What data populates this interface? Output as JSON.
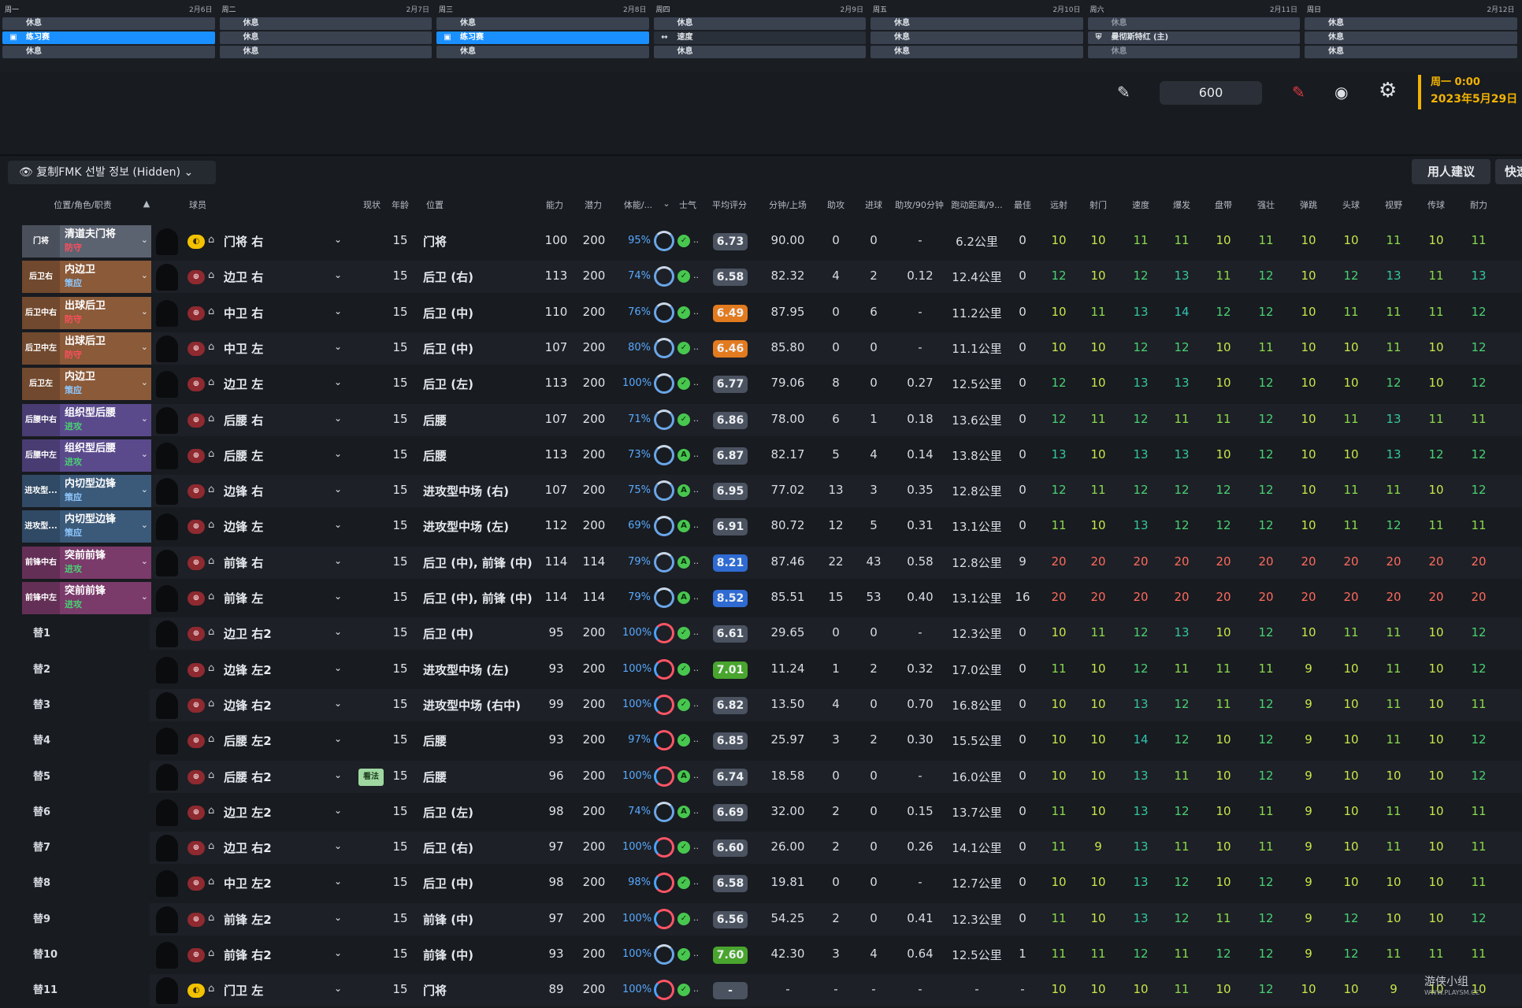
{
  "calendar": {
    "days": [
      {
        "weekday": "周一",
        "date": "2月6日"
      },
      {
        "weekday": "周二",
        "date": "2月7日"
      },
      {
        "weekday": "周三",
        "date": "2月8日"
      },
      {
        "weekday": "周四",
        "date": "2月9日"
      },
      {
        "weekday": "周五",
        "date": "2月10日"
      },
      {
        "weekday": "周六",
        "date": "2月11日"
      },
      {
        "weekday": "周日",
        "date": "2月12日"
      }
    ],
    "slots": [
      [
        {
          "t": "休息",
          "k": "rest"
        },
        {
          "t": "练习赛",
          "k": "train"
        },
        {
          "t": "休息",
          "k": "rest"
        }
      ],
      [
        {
          "t": "休息",
          "k": "rest"
        },
        {
          "t": "休息",
          "k": "rest"
        },
        {
          "t": "休息",
          "k": "rest"
        }
      ],
      [
        {
          "t": "休息",
          "k": "rest"
        },
        {
          "t": "练习赛",
          "k": "train"
        },
        {
          "t": "休息",
          "k": "rest"
        }
      ],
      [
        {
          "t": "休息",
          "k": "rest"
        },
        {
          "t": "速度",
          "k": "dark"
        },
        {
          "t": "休息",
          "k": "rest"
        }
      ],
      [
        {
          "t": "休息",
          "k": "rest"
        },
        {
          "t": "休息",
          "k": "rest"
        },
        {
          "t": "休息",
          "k": "rest"
        }
      ],
      [
        {
          "t": "休息",
          "k": "fade"
        },
        {
          "t": "曼彻斯特红 (主)",
          "k": "match"
        },
        {
          "t": "休息",
          "k": "fade"
        }
      ],
      [
        {
          "t": "休息",
          "k": "rest"
        },
        {
          "t": "休息",
          "k": "rest"
        },
        {
          "t": "休息",
          "k": "rest"
        }
      ]
    ]
  },
  "toolbar": {
    "budget": "600",
    "date_line1": "周一 0:00",
    "date_line2": "2023年5月29日"
  },
  "view_selector": {
    "label": "复制FMK 선발 정보 (Hidden)"
  },
  "buttons": {
    "advice": "用人建议",
    "quick": "快速"
  },
  "headers": {
    "position_role": "位置/角色/职责",
    "player": "球员",
    "status": "现状",
    "age": "年龄",
    "position": "位置",
    "ca": "能力",
    "pa": "潜力",
    "condition": "体能/...",
    "morale": "士气",
    "avg_rating": "平均评分",
    "mins_per_app": "分钟/上场",
    "assists": "助攻",
    "goals": "进球",
    "assists_per90": "助攻/90分钟",
    "distance_per90": "跑动距离/9...",
    "best": "最佳",
    "attrs": [
      "远射",
      "射门",
      "速度",
      "爆发",
      "盘带",
      "强壮",
      "弹跳",
      "头球",
      "视野",
      "传球",
      "耐力"
    ]
  },
  "rows": [
    {
      "code": "门将",
      "role": "清道夫门将",
      "duty": "防守",
      "dc": "#ff4f5e",
      "bg": "#5b6270",
      "badge": "gk",
      "name": "门将 右",
      "age": "15",
      "pos": "门将",
      "ca": "100",
      "pa": "200",
      "cond": "95%",
      "ring": "b",
      "mor": "✓",
      "rating": "6.73",
      "rc": "g",
      "mins": "90.00",
      "ast": "0",
      "gls": "0",
      "a90": "-",
      "dist": "6.2公里",
      "best": "0",
      "attrs": [
        10,
        10,
        11,
        11,
        10,
        11,
        10,
        10,
        11,
        10,
        11
      ]
    },
    {
      "code": "后卫右",
      "role": "内边卫",
      "duty": "策应",
      "dc": "#8fc9ff",
      "bg": "#8a5a39",
      "badge": "out",
      "name": "边卫 右",
      "age": "15",
      "pos": "后卫 (右)",
      "ca": "113",
      "pa": "200",
      "cond": "74%",
      "ring": "b",
      "mor": "✓",
      "rating": "6.58",
      "rc": "g",
      "mins": "82.32",
      "ast": "4",
      "gls": "2",
      "a90": "0.12",
      "dist": "12.4公里",
      "best": "0",
      "attrs": [
        12,
        10,
        12,
        13,
        11,
        12,
        10,
        12,
        13,
        11,
        13
      ]
    },
    {
      "code": "后卫中右",
      "role": "出球后卫",
      "duty": "防守",
      "dc": "#ff4f5e",
      "bg": "#8a5a39",
      "badge": "out",
      "name": "中卫 右",
      "age": "15",
      "pos": "后卫 (中)",
      "ca": "110",
      "pa": "200",
      "cond": "76%",
      "ring": "b",
      "mor": "✓",
      "rating": "6.49",
      "rc": "o",
      "mins": "87.95",
      "ast": "0",
      "gls": "6",
      "a90": "-",
      "dist": "11.2公里",
      "best": "0",
      "attrs": [
        10,
        11,
        13,
        14,
        12,
        12,
        10,
        11,
        11,
        11,
        12
      ]
    },
    {
      "code": "后卫中左",
      "role": "出球后卫",
      "duty": "防守",
      "dc": "#ff4f5e",
      "bg": "#8a5a39",
      "badge": "out",
      "name": "中卫 左",
      "age": "15",
      "pos": "后卫 (中)",
      "ca": "107",
      "pa": "200",
      "cond": "80%",
      "ring": "b",
      "mor": "✓",
      "rating": "6.46",
      "rc": "o",
      "mins": "85.80",
      "ast": "0",
      "gls": "0",
      "a90": "-",
      "dist": "11.1公里",
      "best": "0",
      "attrs": [
        10,
        10,
        12,
        12,
        10,
        11,
        10,
        10,
        11,
        10,
        12
      ]
    },
    {
      "code": "后卫左",
      "role": "内边卫",
      "duty": "策应",
      "dc": "#8fc9ff",
      "bg": "#8a5a39",
      "badge": "out",
      "name": "边卫 左",
      "age": "15",
      "pos": "后卫 (左)",
      "ca": "113",
      "pa": "200",
      "cond": "100%",
      "ring": "b",
      "mor": "✓",
      "rating": "6.77",
      "rc": "g",
      "mins": "79.06",
      "ast": "8",
      "gls": "0",
      "a90": "0.27",
      "dist": "12.5公里",
      "best": "0",
      "attrs": [
        12,
        10,
        13,
        13,
        10,
        12,
        10,
        10,
        12,
        10,
        12
      ]
    },
    {
      "code": "后腰中右",
      "role": "组织型后腰",
      "duty": "进攻",
      "dc": "#49d073",
      "bg": "#5a4a8c",
      "badge": "out",
      "name": "后腰 右",
      "age": "15",
      "pos": "后腰",
      "ca": "107",
      "pa": "200",
      "cond": "71%",
      "ring": "b",
      "mor": "✓",
      "rating": "6.86",
      "rc": "g",
      "mins": "78.00",
      "ast": "6",
      "gls": "1",
      "a90": "0.18",
      "dist": "13.6公里",
      "best": "0",
      "attrs": [
        12,
        11,
        12,
        11,
        11,
        12,
        10,
        11,
        13,
        11,
        11
      ]
    },
    {
      "code": "后腰中左",
      "role": "组织型后腰",
      "duty": "进攻",
      "dc": "#49d073",
      "bg": "#5a4a8c",
      "badge": "out",
      "name": "后腰 左",
      "age": "15",
      "pos": "后腰",
      "ca": "113",
      "pa": "200",
      "cond": "73%",
      "ring": "b",
      "mor": "A",
      "rating": "6.87",
      "rc": "g",
      "mins": "82.17",
      "ast": "5",
      "gls": "4",
      "a90": "0.14",
      "dist": "13.8公里",
      "best": "0",
      "attrs": [
        13,
        10,
        13,
        13,
        10,
        12,
        10,
        10,
        13,
        12,
        12
      ]
    },
    {
      "code": "进攻型...",
      "role": "内切型边锋",
      "duty": "策应",
      "dc": "#8fc9ff",
      "bg": "#3b5a7a",
      "badge": "out",
      "name": "边锋 右",
      "age": "15",
      "pos": "进攻型中场 (右)",
      "ca": "107",
      "pa": "200",
      "cond": "75%",
      "ring": "b",
      "mor": "A",
      "rating": "6.95",
      "rc": "g",
      "mins": "77.02",
      "ast": "13",
      "gls": "3",
      "a90": "0.35",
      "dist": "12.8公里",
      "best": "0",
      "attrs": [
        12,
        11,
        12,
        12,
        12,
        12,
        10,
        11,
        11,
        10,
        12
      ]
    },
    {
      "code": "进攻型...",
      "role": "内切型边锋",
      "duty": "策应",
      "dc": "#8fc9ff",
      "bg": "#3b5a7a",
      "badge": "out",
      "name": "边锋 左",
      "age": "15",
      "pos": "进攻型中场 (左)",
      "ca": "112",
      "pa": "200",
      "cond": "69%",
      "ring": "b",
      "mor": "A",
      "rating": "6.91",
      "rc": "g",
      "mins": "80.72",
      "ast": "12",
      "gls": "5",
      "a90": "0.31",
      "dist": "13.1公里",
      "best": "0",
      "attrs": [
        11,
        10,
        13,
        12,
        12,
        12,
        10,
        11,
        12,
        11,
        11
      ]
    },
    {
      "code": "前锋中右",
      "role": "突前前锋",
      "duty": "进攻",
      "dc": "#49d073",
      "bg": "#7a3a6a",
      "badge": "out",
      "name": "前锋 右",
      "age": "15",
      "pos": "后卫 (中), 前锋 (中)",
      "ca": "114",
      "pa": "114",
      "cond": "79%",
      "ring": "b",
      "mor": "A",
      "rating": "8.21",
      "rc": "b",
      "mins": "87.46",
      "ast": "22",
      "gls": "43",
      "a90": "0.58",
      "dist": "12.8公里",
      "best": "9",
      "attrs": [
        20,
        20,
        20,
        20,
        20,
        20,
        20,
        20,
        20,
        20,
        20
      ]
    },
    {
      "code": "前锋中左",
      "role": "突前前锋",
      "duty": "进攻",
      "dc": "#49d073",
      "bg": "#7a3a6a",
      "badge": "out",
      "name": "前锋 左",
      "age": "15",
      "pos": "后卫 (中), 前锋 (中)",
      "ca": "114",
      "pa": "114",
      "cond": "79%",
      "ring": "b",
      "mor": "A",
      "rating": "8.52",
      "rc": "b",
      "mins": "85.51",
      "ast": "15",
      "gls": "53",
      "a90": "0.40",
      "dist": "13.1公里",
      "best": "16",
      "attrs": [
        20,
        20,
        20,
        20,
        20,
        20,
        20,
        20,
        20,
        20,
        20
      ]
    },
    {
      "code": "替1",
      "sub": true,
      "badge": "out",
      "name": "边卫 右2",
      "age": "15",
      "pos": "后卫 (中)",
      "ca": "95",
      "pa": "200",
      "cond": "100%",
      "ring": "r",
      "mor": "✓",
      "rating": "6.61",
      "rc": "g",
      "mins": "29.65",
      "ast": "0",
      "gls": "0",
      "a90": "-",
      "dist": "12.3公里",
      "best": "0",
      "attrs": [
        10,
        11,
        12,
        13,
        10,
        12,
        10,
        11,
        11,
        10,
        12
      ]
    },
    {
      "code": "替2",
      "sub": true,
      "badge": "out",
      "name": "边锋 左2",
      "age": "15",
      "pos": "进攻型中场 (左)",
      "ca": "93",
      "pa": "200",
      "cond": "100%",
      "ring": "r",
      "mor": "✓",
      "rating": "7.01",
      "rc": "gr",
      "mins": "11.24",
      "ast": "1",
      "gls": "2",
      "a90": "0.32",
      "dist": "17.0公里",
      "best": "0",
      "attrs": [
        11,
        10,
        12,
        11,
        11,
        11,
        9,
        10,
        11,
        10,
        12
      ]
    },
    {
      "code": "替3",
      "sub": true,
      "badge": "out",
      "name": "边锋 右2",
      "age": "15",
      "pos": "进攻型中场 (右中)",
      "ca": "99",
      "pa": "200",
      "cond": "100%",
      "ring": "r",
      "mor": "✓",
      "rating": "6.82",
      "rc": "g",
      "mins": "13.50",
      "ast": "4",
      "gls": "0",
      "a90": "0.70",
      "dist": "16.8公里",
      "best": "0",
      "attrs": [
        10,
        10,
        13,
        12,
        11,
        12,
        9,
        10,
        11,
        10,
        11
      ]
    },
    {
      "code": "替4",
      "sub": true,
      "badge": "out",
      "name": "后腰 左2",
      "age": "15",
      "pos": "后腰",
      "ca": "93",
      "pa": "200",
      "cond": "97%",
      "ring": "r",
      "mor": "✓",
      "rating": "6.85",
      "rc": "g",
      "mins": "25.97",
      "ast": "3",
      "gls": "2",
      "a90": "0.30",
      "dist": "15.5公里",
      "best": "0",
      "attrs": [
        10,
        10,
        14,
        12,
        10,
        12,
        9,
        10,
        11,
        10,
        12
      ]
    },
    {
      "code": "替5",
      "sub": true,
      "badge": "out",
      "tag": "看法",
      "name": "后腰 右2",
      "age": "15",
      "pos": "后腰",
      "ca": "96",
      "pa": "200",
      "cond": "100%",
      "ring": "r",
      "mor": "A",
      "rating": "6.74",
      "rc": "g",
      "mins": "18.58",
      "ast": "0",
      "gls": "0",
      "a90": "-",
      "dist": "16.0公里",
      "best": "0",
      "attrs": [
        10,
        10,
        13,
        11,
        10,
        12,
        9,
        10,
        10,
        10,
        12
      ]
    },
    {
      "code": "替6",
      "sub": true,
      "badge": "out",
      "name": "边卫 左2",
      "age": "15",
      "pos": "后卫 (左)",
      "ca": "98",
      "pa": "200",
      "cond": "74%",
      "ring": "b",
      "mor": "A",
      "rating": "6.69",
      "rc": "g",
      "mins": "32.00",
      "ast": "2",
      "gls": "0",
      "a90": "0.15",
      "dist": "13.7公里",
      "best": "0",
      "attrs": [
        11,
        10,
        13,
        12,
        10,
        11,
        9,
        10,
        11,
        10,
        11
      ]
    },
    {
      "code": "替7",
      "sub": true,
      "badge": "out",
      "name": "边卫 右2",
      "age": "15",
      "pos": "后卫 (右)",
      "ca": "97",
      "pa": "200",
      "cond": "100%",
      "ring": "r",
      "mor": "✓",
      "rating": "6.60",
      "rc": "g",
      "mins": "26.00",
      "ast": "2",
      "gls": "0",
      "a90": "0.26",
      "dist": "14.1公里",
      "best": "0",
      "attrs": [
        11,
        9,
        13,
        11,
        10,
        11,
        9,
        10,
        11,
        10,
        11
      ]
    },
    {
      "code": "替8",
      "sub": true,
      "badge": "out",
      "name": "中卫 左2",
      "age": "15",
      "pos": "后卫 (中)",
      "ca": "98",
      "pa": "200",
      "cond": "98%",
      "ring": "r",
      "mor": "✓",
      "rating": "6.58",
      "rc": "g",
      "mins": "19.81",
      "ast": "0",
      "gls": "0",
      "a90": "-",
      "dist": "12.7公里",
      "best": "0",
      "attrs": [
        10,
        10,
        13,
        12,
        10,
        12,
        9,
        10,
        10,
        10,
        11
      ]
    },
    {
      "code": "替9",
      "sub": true,
      "badge": "out",
      "name": "前锋 左2",
      "age": "15",
      "pos": "前锋 (中)",
      "ca": "97",
      "pa": "200",
      "cond": "100%",
      "ring": "r",
      "mor": "✓",
      "rating": "6.56",
      "rc": "g",
      "mins": "54.25",
      "ast": "2",
      "gls": "0",
      "a90": "0.41",
      "dist": "12.3公里",
      "best": "0",
      "attrs": [
        11,
        10,
        13,
        12,
        11,
        12,
        9,
        12,
        10,
        10,
        12
      ]
    },
    {
      "code": "替10",
      "sub": true,
      "badge": "out",
      "name": "前锋 右2",
      "age": "15",
      "pos": "前锋 (中)",
      "ca": "93",
      "pa": "200",
      "cond": "100%",
      "ring": "b",
      "mor": "✓",
      "rating": "7.60",
      "rc": "gr",
      "mins": "42.30",
      "ast": "3",
      "gls": "4",
      "a90": "0.64",
      "dist": "12.5公里",
      "best": "1",
      "attrs": [
        11,
        11,
        12,
        11,
        12,
        12,
        9,
        12,
        11,
        11,
        11
      ]
    },
    {
      "code": "替11",
      "sub": true,
      "badge": "gk",
      "name": "门卫 左",
      "age": "15",
      "pos": "门将",
      "ca": "89",
      "pa": "200",
      "cond": "100%",
      "ring": "r",
      "mor": "✓",
      "rating": "-",
      "rc": "g",
      "mins": "-",
      "ast": "-",
      "gls": "-",
      "a90": "-",
      "dist": "-",
      "best": "-",
      "attrs": [
        10,
        10,
        10,
        11,
        10,
        12,
        10,
        10,
        9,
        10,
        10
      ]
    }
  ],
  "watermark": {
    "text": "游侠小组",
    "sub": "WWW.PLAYSM.CC"
  },
  "colors": {
    "accent": "#1a8fff",
    "date": "#f2b300",
    "bg": "#181b20"
  }
}
